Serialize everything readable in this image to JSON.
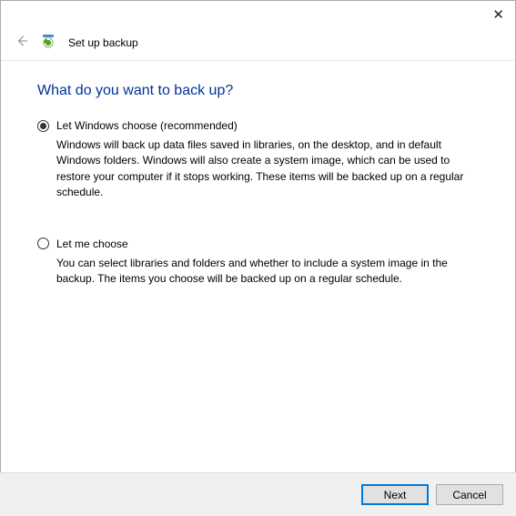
{
  "titlebar": {
    "close_symbol": "✕"
  },
  "header": {
    "title": "Set up backup"
  },
  "main": {
    "heading": "What do you want to back up?"
  },
  "options": {
    "windows_choose": {
      "label": "Let Windows choose (recommended)",
      "description": "Windows will back up data files saved in libraries, on the desktop, and in default Windows folders. Windows will also create a system image, which can be used to restore your computer if it stops working. These items will be backed up on a regular schedule.",
      "selected": true
    },
    "let_me_choose": {
      "label": "Let me choose",
      "description": "You can select libraries and folders and whether to include a system image in the backup. The items you choose will be backed up on a regular schedule.",
      "selected": false
    }
  },
  "buttons": {
    "next": "Next",
    "cancel": "Cancel"
  }
}
